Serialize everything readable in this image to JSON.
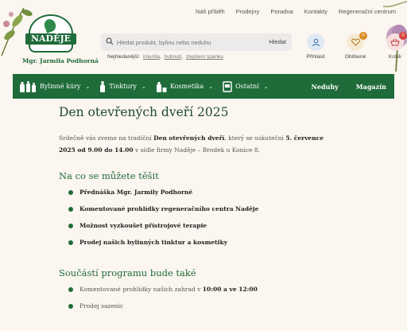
{
  "topnav": [
    "Náš příběh",
    "Prodejny",
    "Poradna",
    "Kontakty",
    "Regenerační centrum"
  ],
  "logo": {
    "word": "NADĚJE",
    "subtitle": "Mgr. Jarmila Podhorná"
  },
  "search": {
    "placeholder": "Hledat produkt, bylinu nebo neduhu",
    "button": "Hledat"
  },
  "popular": {
    "label": "Nejhledanější:",
    "links": [
      "imunita",
      "hubnutí",
      "zlepšení spánku"
    ]
  },
  "user": [
    {
      "label": "Přihlásit",
      "badge": ""
    },
    {
      "label": "Oblíbené",
      "badge": "0"
    },
    {
      "label": "Košík",
      "badge": "0"
    }
  ],
  "mainnav": {
    "left": [
      "Bylinné kúry",
      "Tinktury",
      "Kosmetika",
      "Ostatní"
    ],
    "right": [
      "Neduhy",
      "Magazín"
    ]
  },
  "page": {
    "title": "Den otevřených dveří 2025",
    "intro": {
      "t1": "Srdečně vás zveme na tradiční ",
      "b1": "Den otevřených dveří",
      "t2": ", který se uskuteční ",
      "b2": "5. července 2025 od 9.00 do 14.00",
      "t3": " v sídle firmy Naděje – Brodek u Konice 8."
    },
    "section1": {
      "heading": "Na co se můžete těšit",
      "items": [
        "Přednáška Mgr. Jarmily Podhorné",
        "Komentované prohlídky regeneračního centra Naděje",
        "Možnost vyzkoušet přístrojové terapie",
        "Prodej našich bylinných tinktur a kosmetiky"
      ]
    },
    "section2": {
      "heading": "Součástí programu bude také",
      "item1": {
        "text": "Komentované prohlídky našich zahrad v ",
        "bold": "10:00 a ve 12:00"
      },
      "item2": "Prodej sazenic"
    }
  },
  "colors": {
    "green": "#1f6b3a",
    "badge_orange": "#d88a1c",
    "badge_red": "#d6453d",
    "background": "#fbf6ef"
  }
}
